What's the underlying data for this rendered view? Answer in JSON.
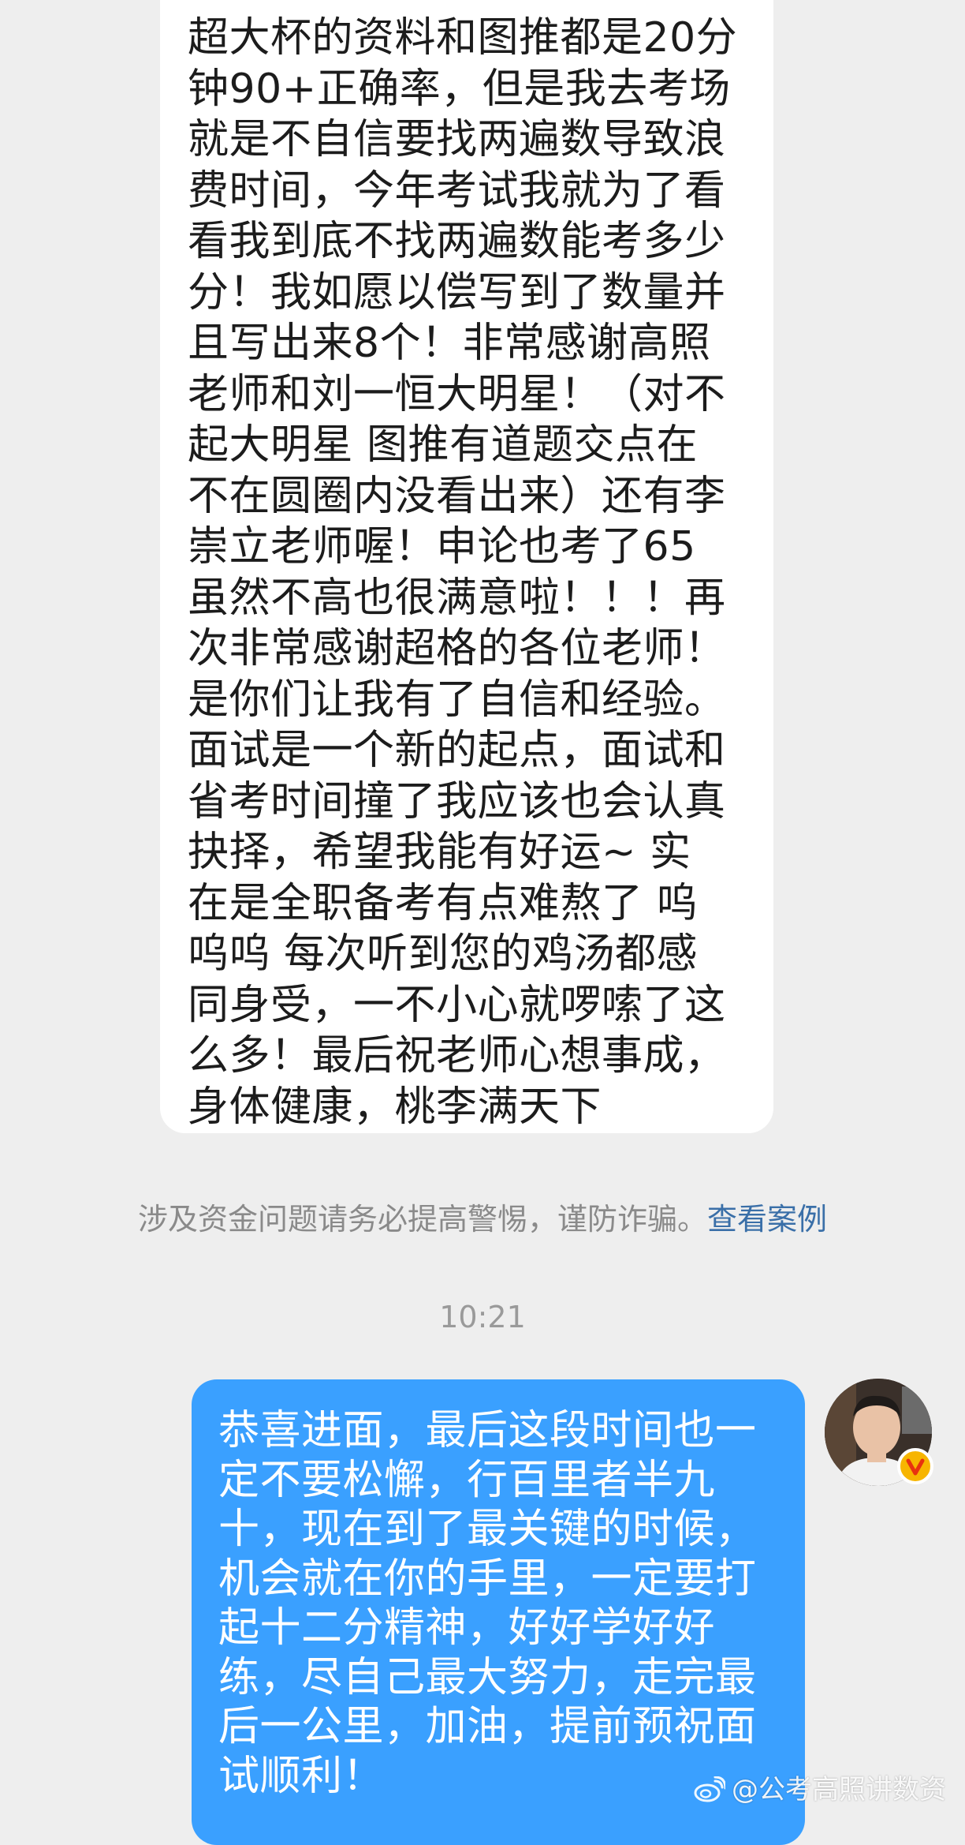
{
  "incoming_message": {
    "text": "超大杯的资料和图推都是20分\n钟90+正确率，但是我去考场\n就是不自信要找两遍数导致浪\n费时间，今年考试我就为了看\n看我到底不找两遍数能考多少\n分！我如愿以偿写到了数量并\n且写出来8个！非常感谢高照\n老师和刘一恒大明星！（对不\n起大明星 图推有道题交点在\n不在圆圈内没看出来）还有李\n崇立老师喔！申论也考了65\n虽然不高也很满意啦！！！再\n次非常感谢超格的各位老师！\n是你们让我有了自信和经验。\n面试是一个新的起点，面试和\n省考时间撞了我应该也会认真\n抉择，希望我能有好运~ 实\n在是全职备考有点难熬了 呜\n呜呜 每次听到您的鸡汤都感\n同身受，一不小心就啰嗦了这\n么多！最后祝老师心想事成，\n身体健康，桃李满天下"
  },
  "security_notice": {
    "text": "涉及资金问题请务必提高警惕，谨防诈骗。",
    "link_label": "查看案例"
  },
  "timestamp": "10:21",
  "outgoing_message": {
    "text": "恭喜进面，最后这段时间也一\n定不要松懈，行百里者半九\n十，现在到了最关键的时候，\n机会就在你的手里，一定要打\n起十二分精神，好好学好好\n练，尽自己最大努力，走完最\n后一公里，加油，提前预祝面\n试顺利！"
  },
  "watermark": {
    "text": "@公考高照讲数资",
    "icon": "weibo-icon"
  },
  "colors": {
    "background": "#eeeeee",
    "incoming_bubble": "#ffffff",
    "outgoing_bubble": "#3aa0ff",
    "link": "#3a6fa8",
    "verified_badge": "#f7b500"
  }
}
